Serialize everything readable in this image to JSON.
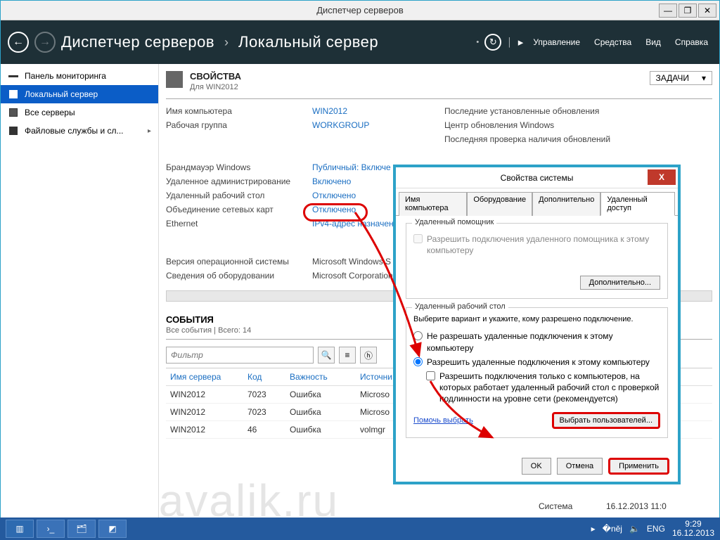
{
  "window": {
    "title": "Диспетчер серверов"
  },
  "nav": {
    "breadcrumb": [
      "Диспетчер серверов",
      "Локальный сервер"
    ],
    "menu": [
      "Управление",
      "Средства",
      "Вид",
      "Справка"
    ]
  },
  "sidebar": {
    "items": [
      {
        "label": "Панель мониторинга"
      },
      {
        "label": "Локальный сервер"
      },
      {
        "label": "Все серверы"
      },
      {
        "label": "Файловые службы и сл..."
      }
    ]
  },
  "properties": {
    "heading": "СВОЙСТВА",
    "sub": "Для WIN2012",
    "tasks_label": "ЗАДАЧИ",
    "rows": [
      {
        "label": "Имя компьютера",
        "value": "WIN2012",
        "right": "Последние установленные обновления"
      },
      {
        "label": "Рабочая группа",
        "value": "WORKGROUP",
        "right": "Центр обновления Windows"
      },
      {
        "label": "",
        "value": "",
        "right": "Последняя проверка наличия обновлений"
      },
      {
        "label": "Брандмауэр Windows",
        "value": "Публичный: Включе"
      },
      {
        "label": "Удаленное администрирование",
        "value": "Включено"
      },
      {
        "label": "Удаленный рабочий стол",
        "value": "Отключено"
      },
      {
        "label": "Объединение сетевых карт",
        "value": "Отключено"
      },
      {
        "label": "Ethernet",
        "value": "IPv4-адрес назначен"
      },
      {
        "label": "Версия операционной системы",
        "value": "Microsoft Windows S"
      },
      {
        "label": "Сведения об оборудовании",
        "value": "Microsoft Corporation"
      }
    ]
  },
  "events": {
    "heading": "СОБЫТИЯ",
    "sub": "Все события | Всего: 14",
    "filter_placeholder": "Фильтр",
    "cols": [
      "Имя сервера",
      "Код",
      "Важность",
      "Источни"
    ],
    "rows": [
      {
        "server": "WIN2012",
        "code": "7023",
        "sev": "Ошибка",
        "src": "Microso"
      },
      {
        "server": "WIN2012",
        "code": "7023",
        "sev": "Ошибка",
        "src": "Microso"
      },
      {
        "server": "WIN2012",
        "code": "46",
        "sev": "Ошибка",
        "src": "volmgr"
      }
    ],
    "extra_cols": {
      "system": "Система",
      "datetime": "16.12.2013 11:0"
    }
  },
  "dialog": {
    "title": "Свойства системы",
    "tabs": [
      "Имя компьютера",
      "Оборудование",
      "Дополнительно",
      "Удаленный доступ"
    ],
    "group1": {
      "legend": "Удаленный помощник",
      "chk": "Разрешить подключения удаленного помощника к этому компьютеру",
      "advanced": "Дополнительно..."
    },
    "group2": {
      "legend": "Удаленный рабочий стол",
      "desc": "Выберите вариант и укажите, кому разрешено подключение.",
      "opt1": "Не разрешать удаленные подключения к этому компьютеру",
      "opt2": "Разрешить удаленные подключения к этому компьютеру",
      "chk": "Разрешить подключения только с компьютеров, на которых работает удаленный рабочий стол с проверкой подлинности на уровне сети (рекомендуется)",
      "help": "Помочь выбрать",
      "select_users": "Выбрать пользователей..."
    },
    "buttons": {
      "ok": "OK",
      "cancel": "Отмена",
      "apply": "Применить"
    }
  },
  "taskbar": {
    "lang": "ENG",
    "time": "9:29",
    "date": "16.12.2013"
  },
  "watermark": "tavalik.ru"
}
